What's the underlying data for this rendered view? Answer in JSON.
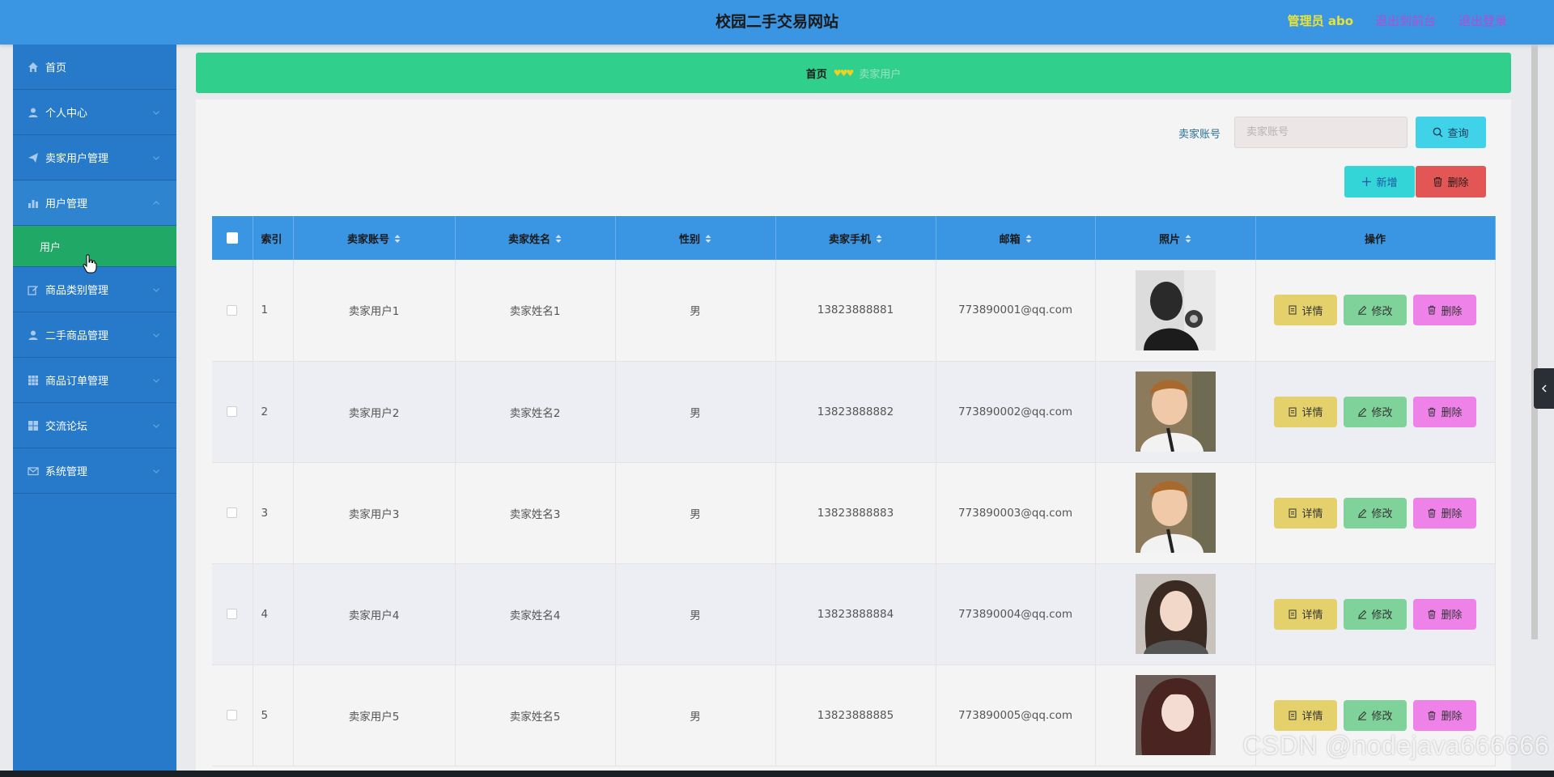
{
  "header": {
    "title": "校园二手交易网站",
    "admin_label": "管理员 abo",
    "front_link": "退出到前台",
    "logout_link": "退出登录"
  },
  "sidebar": {
    "items": [
      {
        "label": "首页",
        "icon": "home-icon"
      },
      {
        "label": "个人中心",
        "icon": "user-icon"
      },
      {
        "label": "卖家用户管理",
        "icon": "send-icon"
      },
      {
        "label": "用户管理",
        "icon": "bar-chart-icon"
      },
      {
        "label": "商品类别管理",
        "icon": "edit-icon"
      },
      {
        "label": "二手商品管理",
        "icon": "user-icon"
      },
      {
        "label": "商品订单管理",
        "icon": "grid-icon"
      },
      {
        "label": "交流论坛",
        "icon": "apps-icon"
      },
      {
        "label": "系统管理",
        "icon": "mail-icon"
      }
    ],
    "submenu": {
      "label": "用户"
    }
  },
  "breadcrumb": {
    "home": "首页",
    "separator": "♥♥♥",
    "current": "卖家用户"
  },
  "search": {
    "label": "卖家账号",
    "placeholder": "卖家账号",
    "button": "查询"
  },
  "toolbar": {
    "add": "新增",
    "delete": "删除"
  },
  "table": {
    "columns": [
      "索引",
      "卖家账号",
      "卖家姓名",
      "性别",
      "卖家手机",
      "邮箱",
      "照片",
      "操作"
    ],
    "rows": [
      {
        "index": "1",
        "account": "卖家用户1",
        "name": "卖家姓名1",
        "gender": "男",
        "phone": "13823888881",
        "email": "773890001@qq.com"
      },
      {
        "index": "2",
        "account": "卖家用户2",
        "name": "卖家姓名2",
        "gender": "男",
        "phone": "13823888882",
        "email": "773890002@qq.com"
      },
      {
        "index": "3",
        "account": "卖家用户3",
        "name": "卖家姓名3",
        "gender": "男",
        "phone": "13823888883",
        "email": "773890003@qq.com"
      },
      {
        "index": "4",
        "account": "卖家用户4",
        "name": "卖家姓名4",
        "gender": "男",
        "phone": "13823888884",
        "email": "773890004@qq.com"
      },
      {
        "index": "5",
        "account": "卖家用户5",
        "name": "卖家姓名5",
        "gender": "男",
        "phone": "13823888885",
        "email": "773890005@qq.com"
      }
    ],
    "actions": {
      "detail": "详情",
      "edit": "修改",
      "delete": "删除"
    }
  },
  "watermark": "CSDN @nodejava666666",
  "colors": {
    "header": "#3a95e2",
    "sidebar": "#2779c9",
    "submenu_active": "#20a866",
    "breadcrumb": "#30cf8b",
    "detail_button": "#e4d16c",
    "edit_button": "#7fd29a",
    "delete_button": "#ee82e8"
  }
}
